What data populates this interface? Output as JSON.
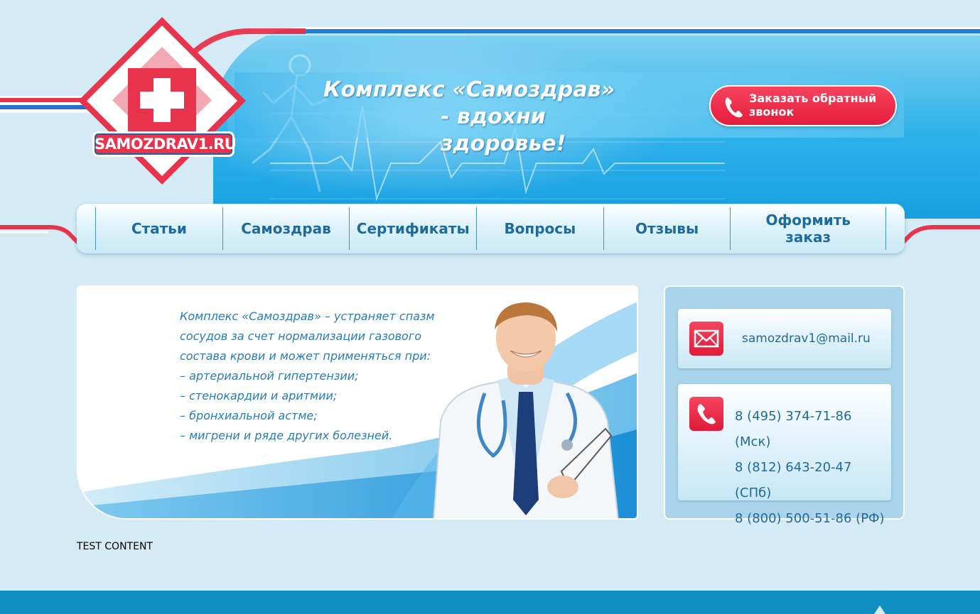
{
  "header": {
    "logo_text": "SAMOZDRAV1.RU",
    "slogan_line1": "Комплекс «Самоздрав»",
    "slogan_line2": "- вдохни здоровье!",
    "callback_label": "Заказать обратный звонок"
  },
  "nav": {
    "items": [
      {
        "label": "Статьи"
      },
      {
        "label": "Самоздрав"
      },
      {
        "label": "Сертификаты"
      },
      {
        "label": "Вопросы"
      },
      {
        "label": "Отзывы"
      },
      {
        "label": "Оформить заказ"
      }
    ]
  },
  "promo": {
    "lines": [
      "Комплекс «Самоздрав» – устраняет спазм",
      "сосудов за счет нормализации газового",
      "состава крови и может применяться при:",
      "– артериальной гипертензии;",
      "– стенокардии и аритмии;",
      "– бронхиальной астме;",
      "– мигрени и ряде других болезней."
    ]
  },
  "contacts": {
    "email": "samozdrav1@mail.ru",
    "phones": [
      "8 (495) 374-71-86 (Мск)",
      "8 (812) 643-20-47 (СПб)",
      "8 (800) 500-51-86 (РФ)"
    ]
  },
  "body_text": "TEST CONTENT",
  "colors": {
    "accent_red": "#e8334c",
    "accent_blue": "#1f6a9a",
    "header_blue": "#169fe2",
    "background": "#d4ebf5"
  },
  "icons": [
    "envelope-icon",
    "phone-icon",
    "medical-cross-icon"
  ]
}
